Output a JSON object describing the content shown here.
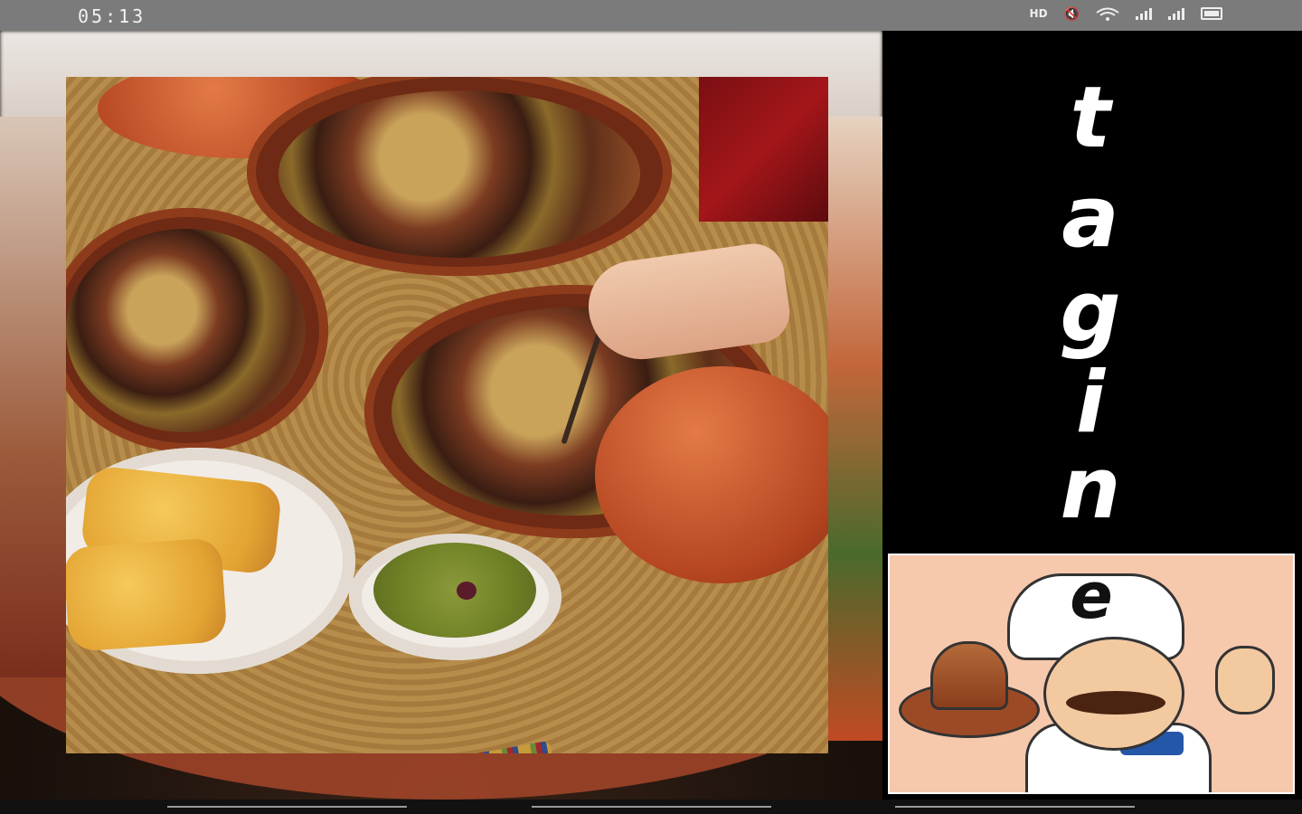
{
  "status_bar": {
    "time": "05:13",
    "icons": [
      "hd-icon",
      "mute-icon",
      "wifi-icon",
      "signal-icon",
      "signal-icon",
      "battery-icon"
    ]
  },
  "app": {
    "title_letters": [
      "t",
      "a",
      "g",
      "i",
      "n"
    ],
    "last_letter": "e"
  },
  "images": {
    "main_photo": "moroccan-tajine-dishes",
    "chef_illustration": "chef-holding-tajine"
  }
}
